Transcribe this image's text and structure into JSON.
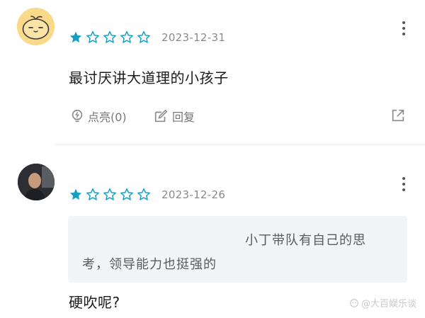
{
  "reviews": [
    {
      "avatar_icon": "tangerine-avatar-icon",
      "rating": 1,
      "max_rating": 5,
      "date": "2023-12-31",
      "text": "最讨厌讲大道理的小孩子",
      "like_label": "点亮(0)",
      "reply_label": "回复",
      "share_icon": "share-icon",
      "more_icon": "more-vertical-icon"
    },
    {
      "avatar_icon": "user-photo-avatar",
      "rating": 1,
      "max_rating": 5,
      "date": "2023-12-26",
      "quote_line1": "小丁带队有自己的思",
      "quote_line2": "考，领导能力也挺强的",
      "text": "硬吹呢?",
      "more_icon": "more-vertical-icon"
    }
  ],
  "watermark": "@大百娱乐谈",
  "colors": {
    "star": "#14a0c3",
    "star_outline": "#14a0c3",
    "date": "#8a8a8a",
    "quote_bg": "#f3f4f7"
  }
}
